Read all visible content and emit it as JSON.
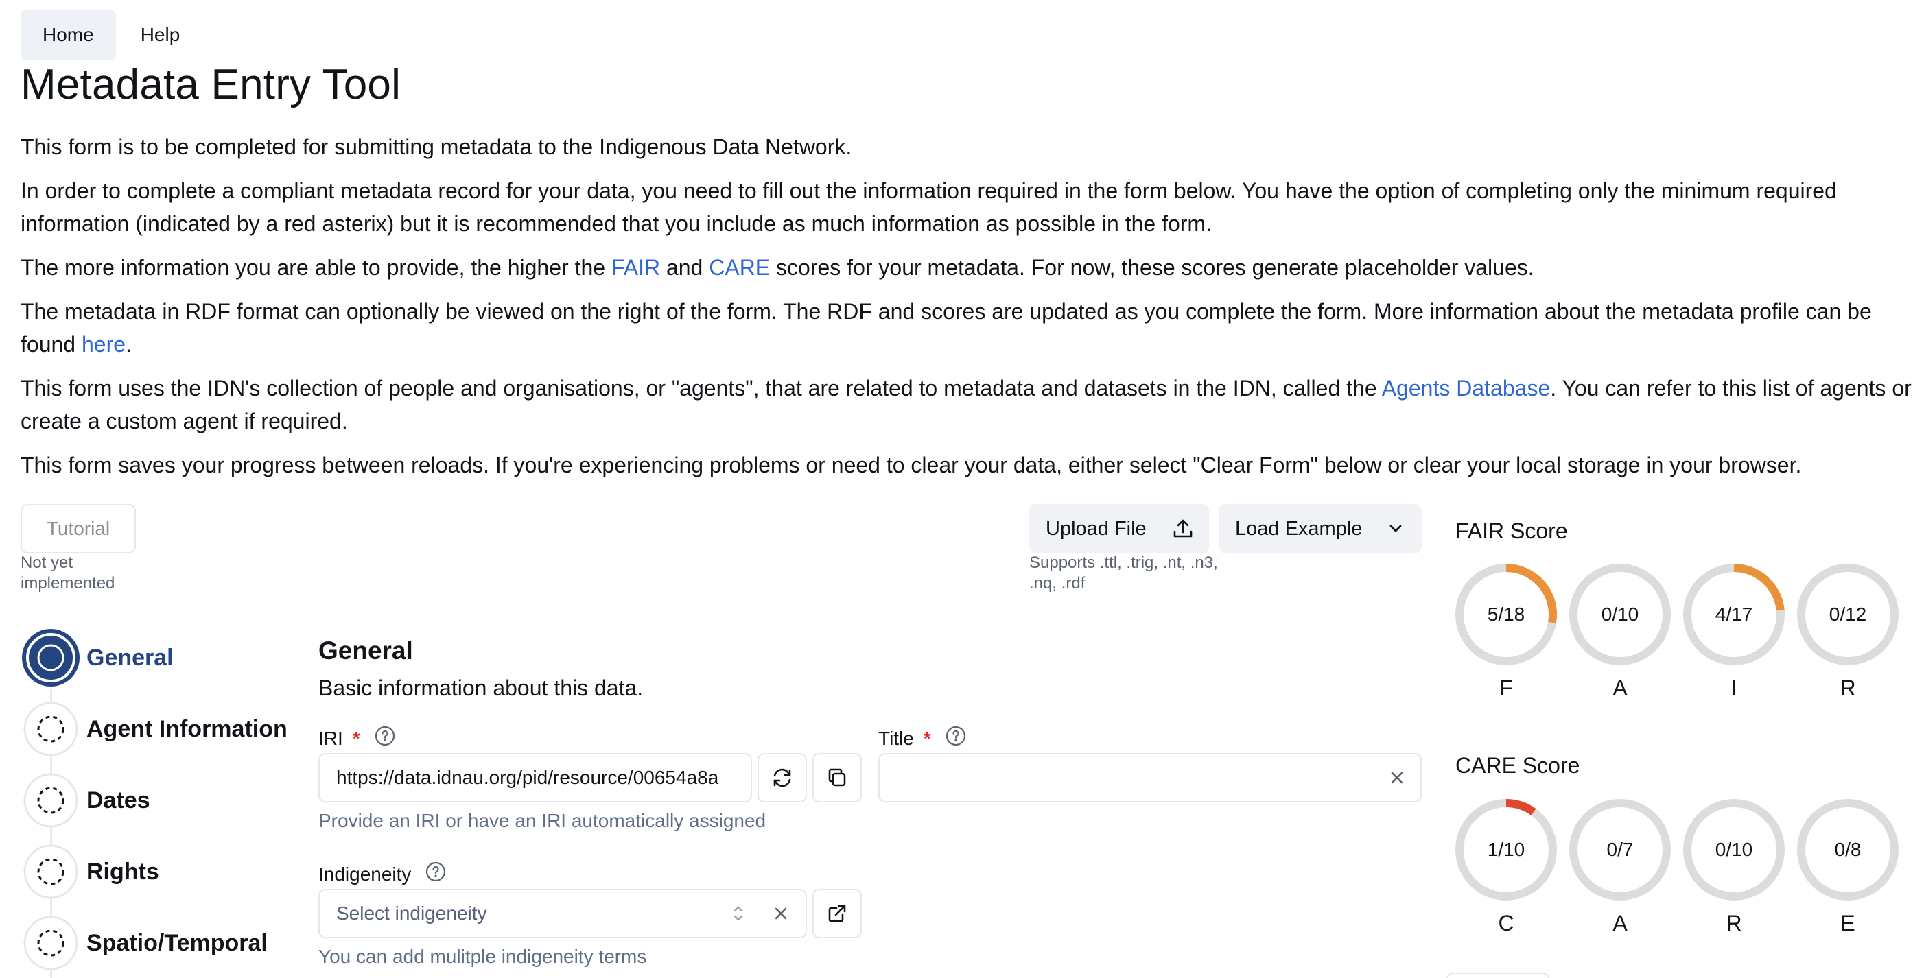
{
  "nav": {
    "tabs": [
      {
        "label": "Home"
      },
      {
        "label": "Help"
      }
    ]
  },
  "page": {
    "title": "Metadata Entry Tool"
  },
  "intro": {
    "p1": "This form is to be completed for submitting metadata to the Indigenous Data Network.",
    "p2": "In order to complete a compliant metadata record for your data, you need to fill out the information required in the form below. You have the option of completing only the minimum required information (indicated by a red asterix) but it is recommended that you include as much information as possible in the form.",
    "p3_before": "The more information you are able to provide, the higher the ",
    "p3_fair": "FAIR",
    "p3_and": " and ",
    "p3_care": "CARE",
    "p3_after": " scores for your metadata. For now, these scores generate placeholder values.",
    "p4_before": "The metadata in RDF format can optionally be viewed on the right of the form. The RDF and scores are updated as you complete the form. More information about the metadata profile can be found ",
    "p4_link": "here",
    "p4_after": ".",
    "p5_before": "This form uses the IDN's collection of people and organisations, or \"agents\", that are related to metadata and datasets in the IDN, called the ",
    "p5_link": "Agents Database",
    "p5_after": ". You can refer to this list of agents or create a custom agent if required.",
    "p6": "This form saves your progress between reloads. If you're experiencing problems or need to clear your data, either select \"Clear Form\" below or clear your local storage in your browser."
  },
  "tutorial": {
    "label": "Tutorial",
    "note": "Not yet implemented"
  },
  "toolbar": {
    "upload_label": "Upload File",
    "load_label": "Load Example",
    "support_note": "Supports .ttl, .trig, .nt, .n3, .nq, .rdf"
  },
  "steps": [
    {
      "label": "General",
      "active": true
    },
    {
      "label": "Agent Information",
      "active": false
    },
    {
      "label": "Dates",
      "active": false
    },
    {
      "label": "Rights",
      "active": false
    },
    {
      "label": "Spatio/Temporal",
      "active": false
    }
  ],
  "form": {
    "section_title": "General",
    "section_desc": "Basic information about this data.",
    "iri": {
      "label": "IRI",
      "required": "*",
      "value": "https://data.idnau.org/pid/resource/00654a8a",
      "hint": "Provide an IRI or have an IRI automatically assigned"
    },
    "title": {
      "label": "Title",
      "required": "*",
      "value": ""
    },
    "indigeneity": {
      "label": "Indigeneity",
      "placeholder": "Select indigeneity",
      "hint": "You can add mulitple indigeneity terms"
    }
  },
  "scores": {
    "fair": {
      "title": "FAIR Score",
      "items": [
        {
          "letter": "F",
          "value": 5,
          "max": 18,
          "text": "5/18"
        },
        {
          "letter": "A",
          "value": 0,
          "max": 10,
          "text": "0/10"
        },
        {
          "letter": "I",
          "value": 4,
          "max": 17,
          "text": "4/17"
        },
        {
          "letter": "R",
          "value": 0,
          "max": 12,
          "text": "0/12"
        }
      ],
      "color": "#e8933a"
    },
    "care": {
      "title": "CARE Score",
      "items": [
        {
          "letter": "C",
          "value": 1,
          "max": 10,
          "text": "1/10"
        },
        {
          "letter": "A",
          "value": 0,
          "max": 7,
          "text": "0/7"
        },
        {
          "letter": "R",
          "value": 0,
          "max": 10,
          "text": "0/10"
        },
        {
          "letter": "E",
          "value": 0,
          "max": 8,
          "text": "0/8"
        }
      ],
      "color": "#e0482d"
    },
    "track_color": "#dcdcdc"
  },
  "colors": {
    "link": "#2d66d6",
    "active_step": "#24457f",
    "required": "#e02424"
  }
}
